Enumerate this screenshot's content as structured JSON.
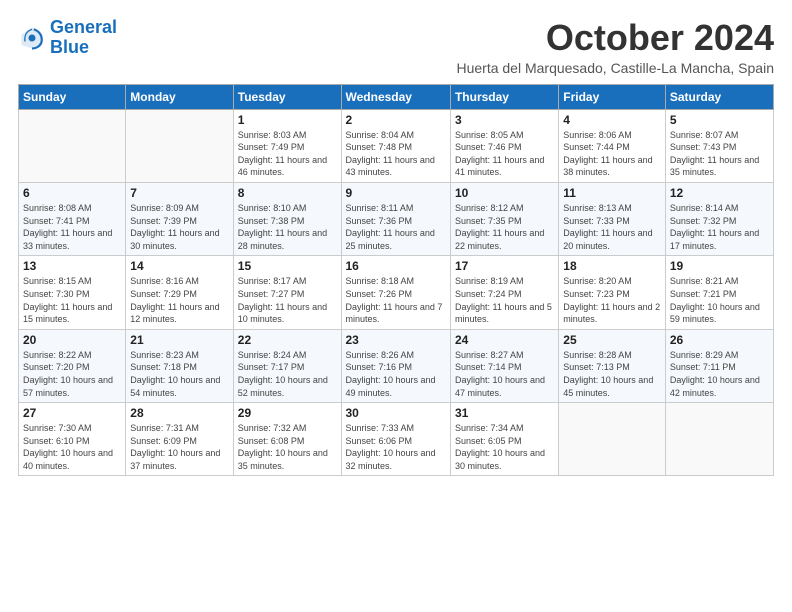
{
  "logo": {
    "line1": "General",
    "line2": "Blue"
  },
  "title": "October 2024",
  "location": "Huerta del Marquesado, Castille-La Mancha, Spain",
  "days_of_week": [
    "Sunday",
    "Monday",
    "Tuesday",
    "Wednesday",
    "Thursday",
    "Friday",
    "Saturday"
  ],
  "weeks": [
    [
      {
        "day": "",
        "info": ""
      },
      {
        "day": "",
        "info": ""
      },
      {
        "day": "1",
        "info": "Sunrise: 8:03 AM\nSunset: 7:49 PM\nDaylight: 11 hours and 46 minutes."
      },
      {
        "day": "2",
        "info": "Sunrise: 8:04 AM\nSunset: 7:48 PM\nDaylight: 11 hours and 43 minutes."
      },
      {
        "day": "3",
        "info": "Sunrise: 8:05 AM\nSunset: 7:46 PM\nDaylight: 11 hours and 41 minutes."
      },
      {
        "day": "4",
        "info": "Sunrise: 8:06 AM\nSunset: 7:44 PM\nDaylight: 11 hours and 38 minutes."
      },
      {
        "day": "5",
        "info": "Sunrise: 8:07 AM\nSunset: 7:43 PM\nDaylight: 11 hours and 35 minutes."
      }
    ],
    [
      {
        "day": "6",
        "info": "Sunrise: 8:08 AM\nSunset: 7:41 PM\nDaylight: 11 hours and 33 minutes."
      },
      {
        "day": "7",
        "info": "Sunrise: 8:09 AM\nSunset: 7:39 PM\nDaylight: 11 hours and 30 minutes."
      },
      {
        "day": "8",
        "info": "Sunrise: 8:10 AM\nSunset: 7:38 PM\nDaylight: 11 hours and 28 minutes."
      },
      {
        "day": "9",
        "info": "Sunrise: 8:11 AM\nSunset: 7:36 PM\nDaylight: 11 hours and 25 minutes."
      },
      {
        "day": "10",
        "info": "Sunrise: 8:12 AM\nSunset: 7:35 PM\nDaylight: 11 hours and 22 minutes."
      },
      {
        "day": "11",
        "info": "Sunrise: 8:13 AM\nSunset: 7:33 PM\nDaylight: 11 hours and 20 minutes."
      },
      {
        "day": "12",
        "info": "Sunrise: 8:14 AM\nSunset: 7:32 PM\nDaylight: 11 hours and 17 minutes."
      }
    ],
    [
      {
        "day": "13",
        "info": "Sunrise: 8:15 AM\nSunset: 7:30 PM\nDaylight: 11 hours and 15 minutes."
      },
      {
        "day": "14",
        "info": "Sunrise: 8:16 AM\nSunset: 7:29 PM\nDaylight: 11 hours and 12 minutes."
      },
      {
        "day": "15",
        "info": "Sunrise: 8:17 AM\nSunset: 7:27 PM\nDaylight: 11 hours and 10 minutes."
      },
      {
        "day": "16",
        "info": "Sunrise: 8:18 AM\nSunset: 7:26 PM\nDaylight: 11 hours and 7 minutes."
      },
      {
        "day": "17",
        "info": "Sunrise: 8:19 AM\nSunset: 7:24 PM\nDaylight: 11 hours and 5 minutes."
      },
      {
        "day": "18",
        "info": "Sunrise: 8:20 AM\nSunset: 7:23 PM\nDaylight: 11 hours and 2 minutes."
      },
      {
        "day": "19",
        "info": "Sunrise: 8:21 AM\nSunset: 7:21 PM\nDaylight: 10 hours and 59 minutes."
      }
    ],
    [
      {
        "day": "20",
        "info": "Sunrise: 8:22 AM\nSunset: 7:20 PM\nDaylight: 10 hours and 57 minutes."
      },
      {
        "day": "21",
        "info": "Sunrise: 8:23 AM\nSunset: 7:18 PM\nDaylight: 10 hours and 54 minutes."
      },
      {
        "day": "22",
        "info": "Sunrise: 8:24 AM\nSunset: 7:17 PM\nDaylight: 10 hours and 52 minutes."
      },
      {
        "day": "23",
        "info": "Sunrise: 8:26 AM\nSunset: 7:16 PM\nDaylight: 10 hours and 49 minutes."
      },
      {
        "day": "24",
        "info": "Sunrise: 8:27 AM\nSunset: 7:14 PM\nDaylight: 10 hours and 47 minutes."
      },
      {
        "day": "25",
        "info": "Sunrise: 8:28 AM\nSunset: 7:13 PM\nDaylight: 10 hours and 45 minutes."
      },
      {
        "day": "26",
        "info": "Sunrise: 8:29 AM\nSunset: 7:11 PM\nDaylight: 10 hours and 42 minutes."
      }
    ],
    [
      {
        "day": "27",
        "info": "Sunrise: 7:30 AM\nSunset: 6:10 PM\nDaylight: 10 hours and 40 minutes."
      },
      {
        "day": "28",
        "info": "Sunrise: 7:31 AM\nSunset: 6:09 PM\nDaylight: 10 hours and 37 minutes."
      },
      {
        "day": "29",
        "info": "Sunrise: 7:32 AM\nSunset: 6:08 PM\nDaylight: 10 hours and 35 minutes."
      },
      {
        "day": "30",
        "info": "Sunrise: 7:33 AM\nSunset: 6:06 PM\nDaylight: 10 hours and 32 minutes."
      },
      {
        "day": "31",
        "info": "Sunrise: 7:34 AM\nSunset: 6:05 PM\nDaylight: 10 hours and 30 minutes."
      },
      {
        "day": "",
        "info": ""
      },
      {
        "day": "",
        "info": ""
      }
    ]
  ]
}
